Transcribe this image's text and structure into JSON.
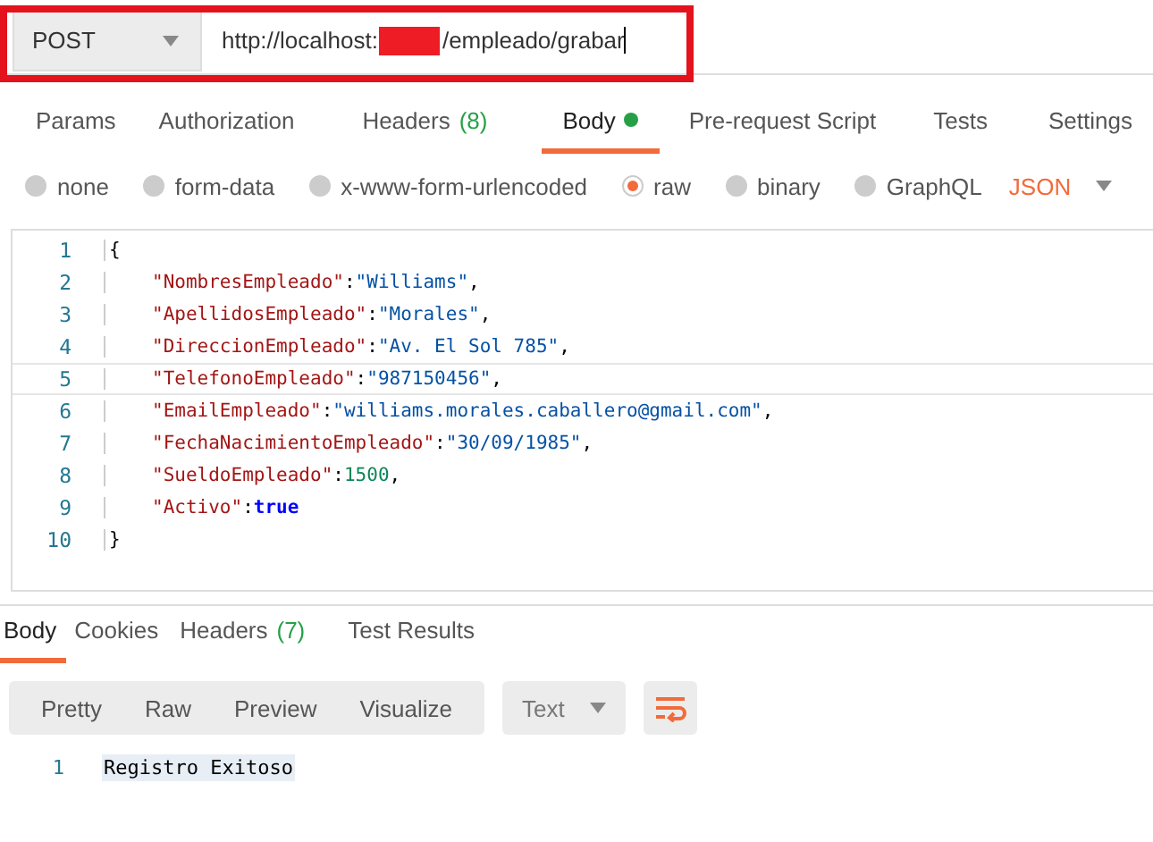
{
  "request": {
    "highlighted": true,
    "method": "POST",
    "url_before": "http://localhost:",
    "url_redacted": true,
    "url_after": "/empleado/grabar"
  },
  "request_tabs": [
    {
      "label": "Params",
      "selected": false
    },
    {
      "label": "Authorization",
      "selected": false
    },
    {
      "label": "Headers",
      "count": "(8)",
      "selected": false
    },
    {
      "label": "Body",
      "dot": true,
      "selected": true
    },
    {
      "label": "Pre-request Script",
      "selected": false
    },
    {
      "label": "Tests",
      "selected": false
    },
    {
      "label": "Settings",
      "selected": false
    }
  ],
  "body_types": [
    {
      "label": "none",
      "selected": false
    },
    {
      "label": "form-data",
      "selected": false
    },
    {
      "label": "x-www-form-urlencoded",
      "selected": false
    },
    {
      "label": "raw",
      "selected": true
    },
    {
      "label": "binary",
      "selected": false
    },
    {
      "label": "GraphQL",
      "selected": false
    }
  ],
  "format": "JSON",
  "editor_lines": [
    {
      "number": "1",
      "indented": false,
      "active": false,
      "tokens": [
        {
          "kind": "punct",
          "text": "{"
        }
      ]
    },
    {
      "number": "2",
      "indented": true,
      "active": false,
      "tokens": [
        {
          "kind": "key",
          "text": "\"NombresEmpleado\""
        },
        {
          "kind": "punct",
          "text": ":"
        },
        {
          "kind": "string",
          "text": "\"Williams\""
        },
        {
          "kind": "punct",
          "text": ","
        }
      ]
    },
    {
      "number": "3",
      "indented": true,
      "active": false,
      "tokens": [
        {
          "kind": "key",
          "text": "\"ApellidosEmpleado\""
        },
        {
          "kind": "punct",
          "text": ":"
        },
        {
          "kind": "string",
          "text": "\"Morales\""
        },
        {
          "kind": "punct",
          "text": ","
        }
      ]
    },
    {
      "number": "4",
      "indented": true,
      "active": false,
      "tokens": [
        {
          "kind": "key",
          "text": "\"DireccionEmpleado\""
        },
        {
          "kind": "punct",
          "text": ":"
        },
        {
          "kind": "string",
          "text": "\"Av. El Sol 785\""
        },
        {
          "kind": "punct",
          "text": ","
        }
      ]
    },
    {
      "number": "5",
      "indented": true,
      "active": true,
      "tokens": [
        {
          "kind": "key",
          "text": "\"TelefonoEmpleado\""
        },
        {
          "kind": "punct",
          "text": ":"
        },
        {
          "kind": "string",
          "text": "\"987150456\""
        },
        {
          "kind": "punct",
          "text": ","
        }
      ]
    },
    {
      "number": "6",
      "indented": true,
      "active": false,
      "tokens": [
        {
          "kind": "key",
          "text": "\"EmailEmpleado\""
        },
        {
          "kind": "punct",
          "text": ":"
        },
        {
          "kind": "string",
          "text": "\"williams.morales.caballero@gmail.com\""
        },
        {
          "kind": "punct",
          "text": ","
        }
      ]
    },
    {
      "number": "7",
      "indented": true,
      "active": false,
      "tokens": [
        {
          "kind": "key",
          "text": "\"FechaNacimientoEmpleado\""
        },
        {
          "kind": "punct",
          "text": ":"
        },
        {
          "kind": "string",
          "text": "\"30/09/1985\""
        },
        {
          "kind": "punct",
          "text": ","
        }
      ]
    },
    {
      "number": "8",
      "indented": true,
      "active": false,
      "tokens": [
        {
          "kind": "key",
          "text": "\"SueldoEmpleado\""
        },
        {
          "kind": "punct",
          "text": ":"
        },
        {
          "kind": "number",
          "text": "1500"
        },
        {
          "kind": "punct",
          "text": ","
        }
      ]
    },
    {
      "number": "9",
      "indented": true,
      "active": false,
      "tokens": [
        {
          "kind": "key",
          "text": "\"Activo\""
        },
        {
          "kind": "punct",
          "text": ":"
        },
        {
          "kind": "bool",
          "text": "true"
        }
      ]
    },
    {
      "number": "10",
      "indented": false,
      "active": false,
      "tokens": [
        {
          "kind": "punct",
          "text": "}"
        }
      ]
    }
  ],
  "response_tabs": [
    {
      "label": "Body",
      "selected": true
    },
    {
      "label": "Cookies",
      "selected": false
    },
    {
      "label": "Headers",
      "count": "(7)",
      "selected": false
    },
    {
      "label": "Test Results",
      "selected": false
    }
  ],
  "view_modes": [
    {
      "label": "Pretty",
      "selected": false
    },
    {
      "label": "Raw",
      "selected": false
    },
    {
      "label": "Preview",
      "selected": false
    },
    {
      "label": "Visualize",
      "selected": false
    }
  ],
  "response_format": "Text",
  "response_lines": [
    {
      "number": "1",
      "text": "Registro Exitoso"
    }
  ]
}
